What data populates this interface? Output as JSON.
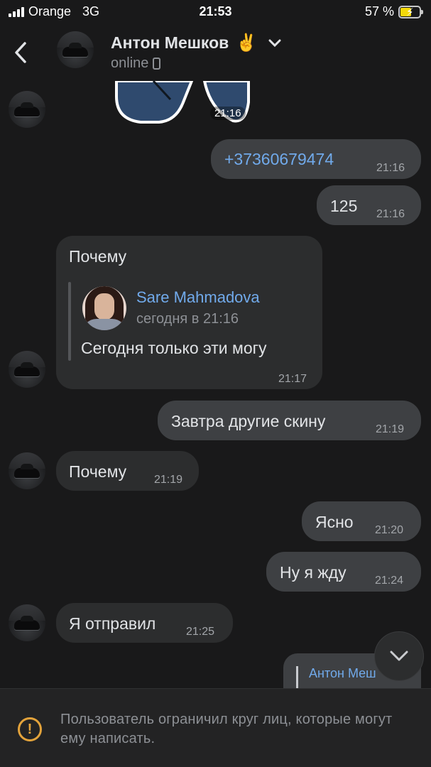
{
  "status_bar": {
    "carrier": "Orange",
    "network": "3G",
    "time": "21:53",
    "battery_percent": "57 %",
    "battery_level": 0.57
  },
  "header": {
    "contact_name": "Антон Мешков",
    "emoji": "✌️",
    "status": "online",
    "back_icon": "chevron-left-icon",
    "menu_icon": "chevron-down-icon"
  },
  "messages": [
    {
      "type": "sticker",
      "direction": "in",
      "time": "21:16"
    },
    {
      "direction": "out",
      "text": "+37360679474",
      "time": "21:16",
      "is_link": true
    },
    {
      "direction": "out",
      "text": "125",
      "time": "21:16"
    },
    {
      "direction": "in",
      "text": "Почему",
      "time": "21:17",
      "reply": {
        "author": "Sare Mahmadova",
        "date": "сегодня в 21:16",
        "text": "Сегодня только эти могу"
      }
    },
    {
      "direction": "out",
      "text": "Завтра другие скину",
      "time": "21:19"
    },
    {
      "direction": "in",
      "text": "Почему",
      "time": "21:19"
    },
    {
      "direction": "out",
      "text": "Ясно",
      "time": "21:20"
    },
    {
      "direction": "out",
      "text": "Ну я жду",
      "time": "21:24"
    },
    {
      "direction": "in",
      "text": "Я отправил",
      "time": "21:25"
    },
    {
      "direction": "out",
      "partial_reply_author": "Антон Меш"
    }
  ],
  "footer": {
    "notice": "Пользователь ограничил круг лиц, которые могут ему написать.",
    "icon": "warning-icon"
  },
  "colors": {
    "background": "#19191a",
    "outgoing_bubble": "#3e4043",
    "incoming_bubble": "#2c2d2e",
    "link": "#71aaeb",
    "warning": "#e3a33b"
  }
}
